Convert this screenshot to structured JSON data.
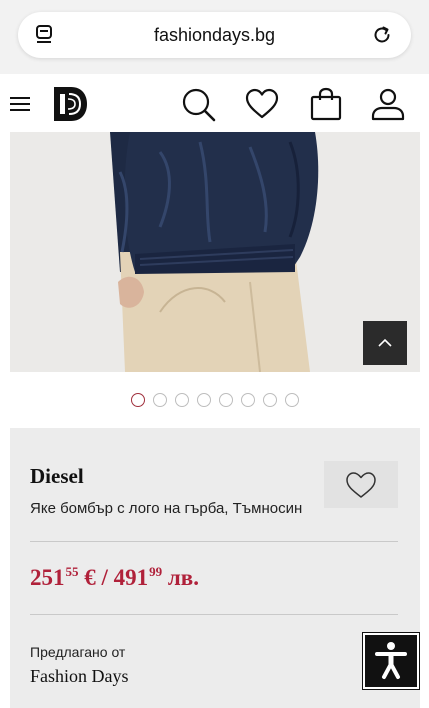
{
  "browser": {
    "url": "fashiondays.bg",
    "icons": {
      "tabs": "tabs-icon",
      "reload": "reload-icon"
    }
  },
  "header": {
    "icons": [
      "menu-icon",
      "logo",
      "search-icon",
      "heart-icon",
      "bag-icon",
      "user-icon"
    ]
  },
  "gallery": {
    "total_images": 8,
    "active_index": 0
  },
  "product": {
    "brand": "Diesel",
    "title": "Яке бомбър с лого на гърба, Тъмносин",
    "price": {
      "eur_int": "251",
      "eur_dec": "55",
      "eur_symbol": "€",
      "separator": "/",
      "bgn_int": "491",
      "bgn_dec": "99",
      "bgn_symbol": "лв."
    },
    "offered_by_label": "Предлагано от",
    "seller": "Fashion Days"
  },
  "colors": {
    "price": "#b0213a",
    "active_dot": "#a0303d",
    "jacket": "#1f2b45",
    "pants": "#e2d2b6"
  }
}
